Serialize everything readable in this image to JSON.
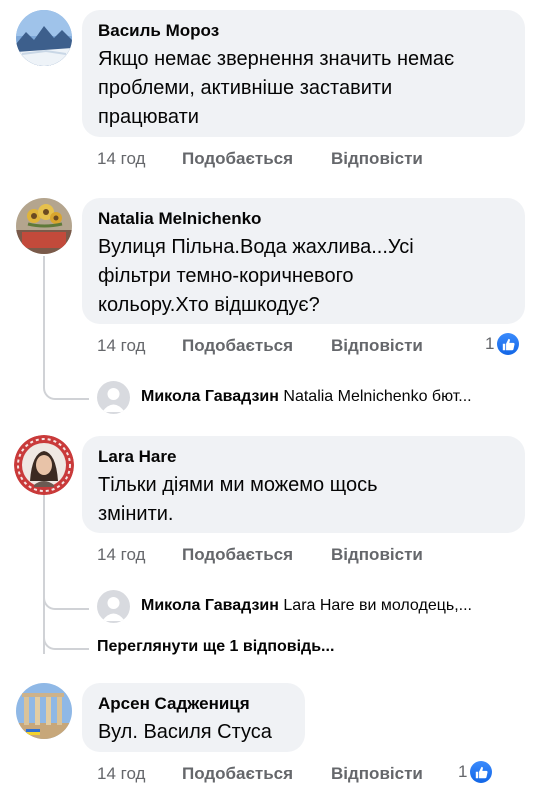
{
  "comments": [
    {
      "author": "Василь Мороз",
      "text_lines": [
        "Якщо немає звернення значить немає",
        "проблеми, активніше заставити",
        "працювати"
      ],
      "time": "14 год",
      "like_label": "Подобається",
      "reply_label": "Відповісти"
    },
    {
      "author": "Natalia Melnichenko",
      "text_lines": [
        "Вулиця Пільна.Вода жахлива...Усі",
        "фільтри темно-коричневого",
        "кольору.Хто відшкодує?"
      ],
      "time": "14 год",
      "like_label": "Подобається",
      "reply_label": "Відповісти",
      "reactions_count": "1",
      "reaction_icon": "thumbs-up-icon",
      "reply_preview": {
        "author": "Микола Гавадзин",
        "text": "Natalia Melnichenko бют..."
      }
    },
    {
      "author": "Lara Hare",
      "text_lines": [
        "Тільки діями ми можемо щось",
        "змінити."
      ],
      "time": "14 год",
      "like_label": "Подобається",
      "reply_label": "Відповісти",
      "reply_preview": {
        "author": "Микола Гавадзин",
        "text": "Lara Hare ви молодець,..."
      },
      "more_replies": "Переглянути ще 1 відповідь..."
    },
    {
      "author": "Арсен Саджениця",
      "text_lines": [
        "Вул. Василя Стуса"
      ],
      "time": "14 год",
      "like_label": "Подобається",
      "reply_label": "Відповісти",
      "reactions_count": "1",
      "reaction_icon": "thumbs-up-icon"
    }
  ],
  "colors": {
    "reaction_blue": "#1877f2",
    "bubble_bg": "#f0f2f5",
    "meta_text": "#65676b"
  }
}
